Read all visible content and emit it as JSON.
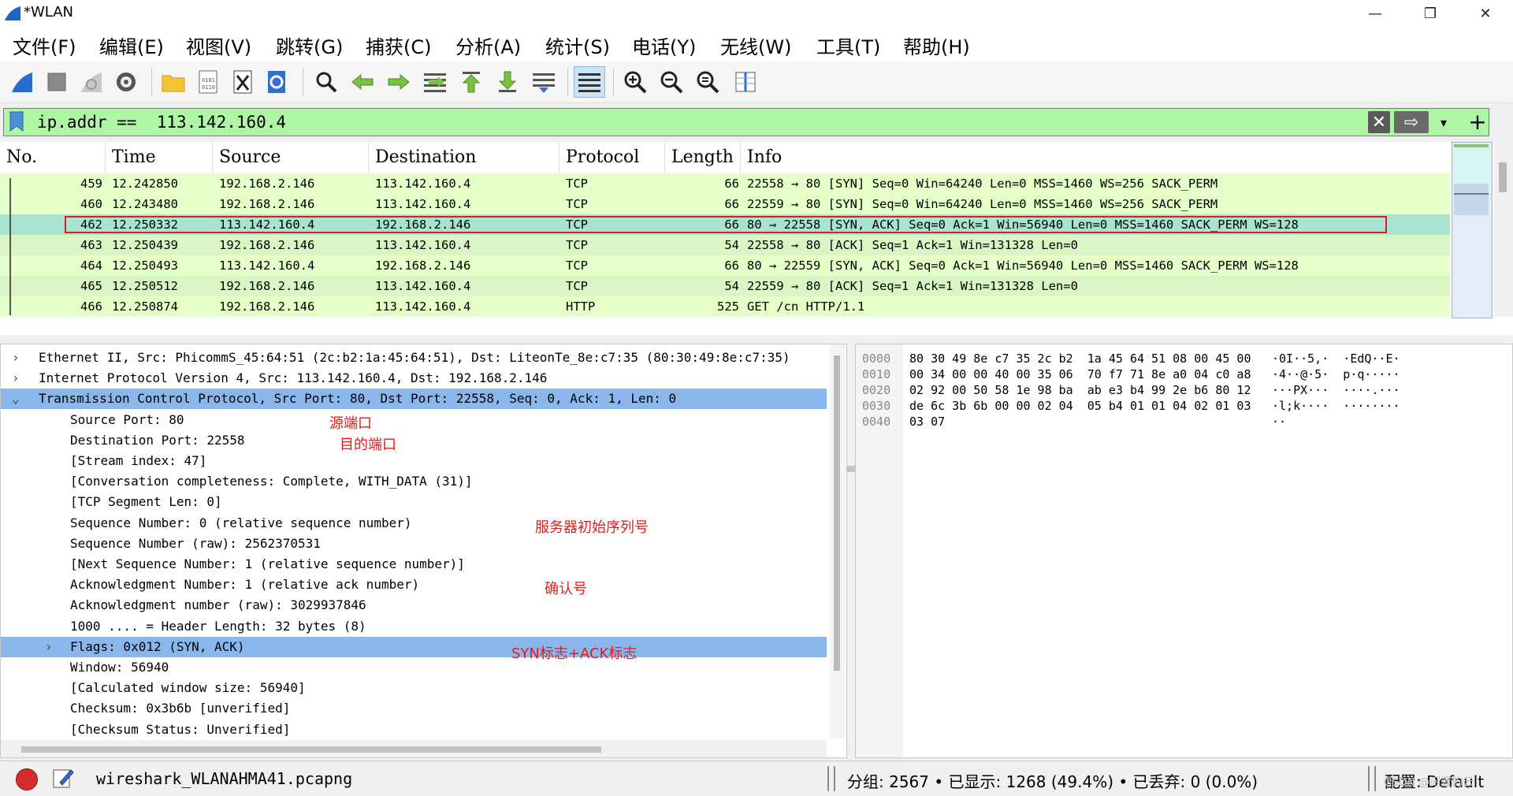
{
  "window": {
    "title": "*WLAN",
    "minimize": "—",
    "restore": "❐",
    "close": "✕"
  },
  "menu": [
    "文件(F)",
    "编辑(E)",
    "视图(V)",
    "跳转(G)",
    "捕获(C)",
    "分析(A)",
    "统计(S)",
    "电话(Y)",
    "无线(W)",
    "工具(T)",
    "帮助(H)"
  ],
  "toolbar": {
    "icons": [
      "shark-start-icon",
      "stop-icon",
      "restart-icon",
      "capture-options-icon",
      "open-folder-icon",
      "file-icon",
      "close-file-icon",
      "reload-icon",
      "find-icon",
      "go-back-icon",
      "go-forward-icon",
      "go-to-packet-icon",
      "first-packet-icon",
      "last-packet-icon",
      "autoscroll-icon",
      "colorize-icon",
      "zoom-in-icon",
      "zoom-out-icon",
      "zoom-reset-icon",
      "resize-columns-icon"
    ]
  },
  "filter": {
    "value": "ip.addr ==  113.142.160.4",
    "clear": "✕",
    "apply": "⇨",
    "dropdown": "▾",
    "add": "+"
  },
  "packet_list": {
    "columns": [
      "No.",
      "Time",
      "Source",
      "Destination",
      "Protocol",
      "Length",
      "Info"
    ],
    "rows": [
      {
        "no": "459",
        "time": "12.242850",
        "src": "192.168.2.146",
        "dst": "113.142.160.4",
        "proto": "TCP",
        "len": "66",
        "info": "22558 → 80 [SYN] Seq=0 Win=64240 Len=0 MSS=1460 WS=256 SACK_PERM"
      },
      {
        "no": "460",
        "time": "12.243480",
        "src": "192.168.2.146",
        "dst": "113.142.160.4",
        "proto": "TCP",
        "len": "66",
        "info": "22559 → 80 [SYN] Seq=0 Win=64240 Len=0 MSS=1460 WS=256 SACK_PERM"
      },
      {
        "no": "462",
        "time": "12.250332",
        "src": "113.142.160.4",
        "dst": "192.168.2.146",
        "proto": "TCP",
        "len": "66",
        "info": "80 → 22558 [SYN, ACK] Seq=0 Ack=1 Win=56940 Len=0 MSS=1460 SACK_PERM WS=128"
      },
      {
        "no": "463",
        "time": "12.250439",
        "src": "192.168.2.146",
        "dst": "113.142.160.4",
        "proto": "TCP",
        "len": "54",
        "info": "22558 → 80 [ACK] Seq=1 Ack=1 Win=131328 Len=0"
      },
      {
        "no": "464",
        "time": "12.250493",
        "src": "113.142.160.4",
        "dst": "192.168.2.146",
        "proto": "TCP",
        "len": "66",
        "info": "80 → 22559 [SYN, ACK] Seq=0 Ack=1 Win=56940 Len=0 MSS=1460 SACK_PERM WS=128"
      },
      {
        "no": "465",
        "time": "12.250512",
        "src": "192.168.2.146",
        "dst": "113.142.160.4",
        "proto": "TCP",
        "len": "54",
        "info": "22559 → 80 [ACK] Seq=1 Ack=1 Win=131328 Len=0"
      },
      {
        "no": "466",
        "time": "12.250874",
        "src": "192.168.2.146",
        "dst": "113.142.160.4",
        "proto": "HTTP",
        "len": "525",
        "info": "GET /cn HTTP/1.1"
      }
    ]
  },
  "details": {
    "lines": [
      {
        "caret": "›",
        "text": "Ethernet II, Src: PhicommS_45:64:51 (2c:b2:1a:45:64:51), Dst: LiteonTe_8e:c7:35 (80:30:49:8e:c7:35)"
      },
      {
        "caret": "›",
        "text": "Internet Protocol Version 4, Src: 113.142.160.4, Dst: 192.168.2.146"
      },
      {
        "caret": "⌄",
        "text": "Transmission Control Protocol, Src Port: 80, Dst Port: 22558, Seq: 0, Ack: 1, Len: 0"
      },
      {
        "caret": "",
        "text": "Source Port: 80"
      },
      {
        "caret": "",
        "text": "Destination Port: 22558"
      },
      {
        "caret": "",
        "text": "[Stream index: 47]"
      },
      {
        "caret": "",
        "text": "[Conversation completeness: Complete, WITH_DATA (31)]"
      },
      {
        "caret": "",
        "text": "[TCP Segment Len: 0]"
      },
      {
        "caret": "",
        "text": "Sequence Number: 0    (relative sequence number)"
      },
      {
        "caret": "",
        "text": "Sequence Number (raw): 2562370531"
      },
      {
        "caret": "",
        "text": "[Next Sequence Number: 1    (relative sequence number)]"
      },
      {
        "caret": "",
        "text": "Acknowledgment Number: 1    (relative ack number)"
      },
      {
        "caret": "",
        "text": "Acknowledgment number (raw): 3029937846"
      },
      {
        "caret": "",
        "text": "1000 .... = Header Length: 32 bytes (8)"
      },
      {
        "caret": "›",
        "text": "Flags: 0x012 (SYN, ACK)"
      },
      {
        "caret": "",
        "text": "Window: 56940"
      },
      {
        "caret": "",
        "text": "[Calculated window size: 56940]"
      },
      {
        "caret": "",
        "text": "Checksum: 0x3b6b [unverified]"
      },
      {
        "caret": "",
        "text": "[Checksum Status: Unverified]"
      }
    ],
    "annotations": {
      "src_port": "源端口",
      "dst_port": "目的端口",
      "seq": "服务器初始序列号",
      "ack": "确认号",
      "flags": "SYN标志+ACK标志"
    }
  },
  "bytes": {
    "rows": [
      {
        "offset": "0000",
        "hex": "80 30 49 8e c7 35 2c b2  1a 45 64 51 08 00 45 00",
        "ascii": "·0I··5,·  ·EdQ··E·"
      },
      {
        "offset": "0010",
        "hex": "00 34 00 00 40 00 35 06  70 f7 71 8e a0 04 c0 a8",
        "ascii": "·4··@·5·  p·q·····"
      },
      {
        "offset": "0020",
        "hex": "02 92 00 50 58 1e 98 ba  ab e3 b4 99 2e b6 80 12",
        "ascii": "···PX···  ····.···"
      },
      {
        "offset": "0030",
        "hex": "de 6c 3b 6b 00 00 02 04  05 b4 01 01 04 02 01 03",
        "ascii": "·l;k····  ········"
      },
      {
        "offset": "0040",
        "hex": "03 07",
        "ascii": "··"
      }
    ]
  },
  "status": {
    "file": "wireshark_WLANAHMA41.pcapng",
    "stats": "分组: 2567  •  已显示: 1268 (49.4%)  •  已丢弃: 0 (0.0%)",
    "profile": "配置: Default",
    "watermark": "CSDN @闲置的云"
  },
  "colors": {
    "filter_bg": "#aff5a6",
    "row_bg": "#e4ffc7",
    "selected_row_bg": "#a8e2d0",
    "details_highlight": "#89b7ec",
    "annotation": "#e21b1b"
  }
}
